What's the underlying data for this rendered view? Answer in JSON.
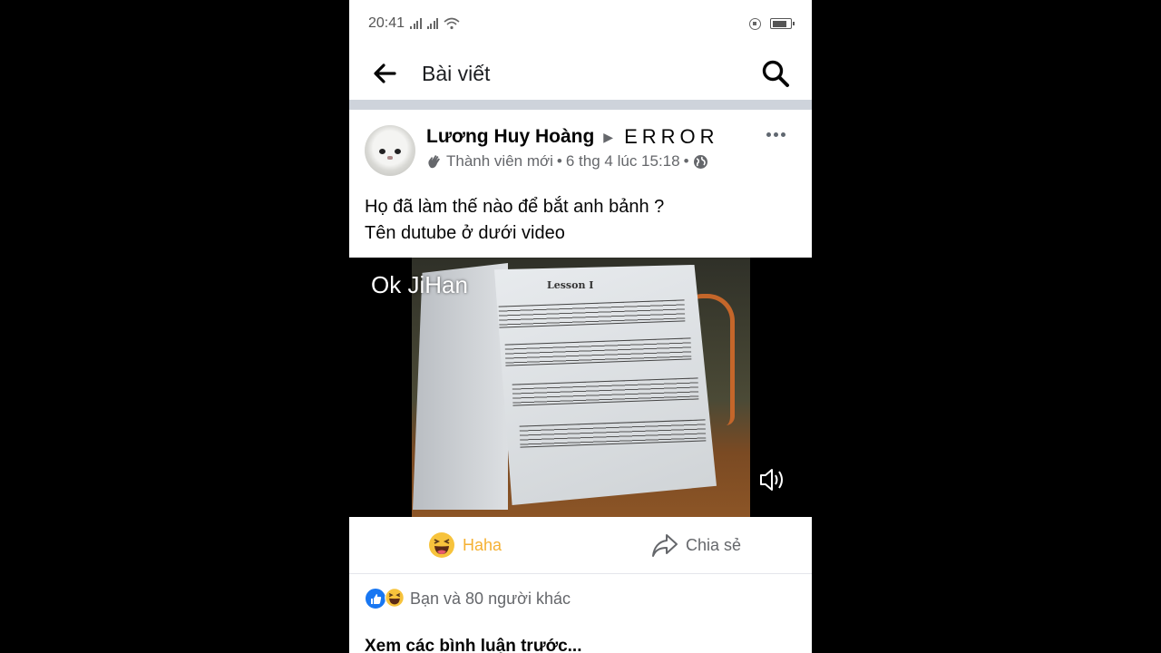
{
  "statusbar": {
    "time": "20:41",
    "icons": [
      "signal-icon",
      "signal-icon",
      "wifi-icon",
      "rotation-lock-icon",
      "battery-icon"
    ]
  },
  "appbar": {
    "title": "Bài viết",
    "back_icon": "arrow-left-icon",
    "search_icon": "search-icon"
  },
  "post": {
    "author": "Lương Huy Hoàng",
    "separator": "▶",
    "group": "ERROR",
    "member_badge": "Thành viên mới",
    "dot": "•",
    "timestamp": "6 thg 4 lúc 15:18",
    "dot2": "•",
    "privacy_icon": "globe-icon",
    "text_line1": "Họ đã làm thế nào để bắt anh bảnh ?",
    "text_line2": "Tên dutube ở dưới video"
  },
  "video": {
    "overlay_text": "Ok JiHan",
    "sheet_title": "Lesson I",
    "volume_icon": "volume-icon"
  },
  "actions": {
    "haha_label": "Haha",
    "share_label": "Chia sẻ"
  },
  "reactions": {
    "summary": "Bạn và 80 người khác"
  },
  "comments": {
    "previous_label": "Xem các bình luận trước..."
  },
  "colors": {
    "accent_haha": "#f5b133",
    "like_blue": "#1877f2",
    "divider": "#ced3db"
  }
}
